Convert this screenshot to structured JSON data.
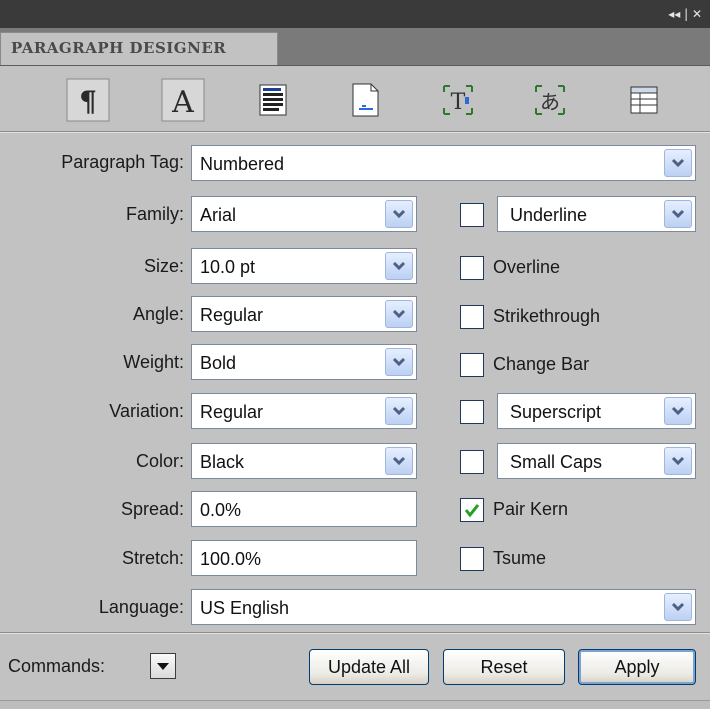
{
  "window": {
    "title_controls": "◂◂ | ✕"
  },
  "tab": {
    "label": "PARAGRAPH DESIGNER"
  },
  "toolbar": {
    "buttons": [
      {
        "icon": "pilcrow-icon"
      },
      {
        "icon": "font-icon"
      },
      {
        "icon": "paragraph-format-icon"
      },
      {
        "icon": "pagination-icon"
      },
      {
        "icon": "text-frame-icon"
      },
      {
        "icon": "asian-text-icon"
      },
      {
        "icon": "table-cell-icon"
      }
    ]
  },
  "paragraph_tag": {
    "label": "Paragraph Tag:",
    "value": "Numbered"
  },
  "family": {
    "label": "Family:",
    "value": "Arial"
  },
  "size": {
    "label": "Size:",
    "value": "10.0 pt"
  },
  "angle": {
    "label": "Angle:",
    "value": "Regular"
  },
  "weight": {
    "label": "Weight:",
    "value": "Bold"
  },
  "variation": {
    "label": "Variation:",
    "value": "Regular"
  },
  "color": {
    "label": "Color:",
    "value": "Black"
  },
  "spread": {
    "label": "Spread:",
    "value": "0.0%"
  },
  "stretch": {
    "label": "Stretch:",
    "value": "100.0%"
  },
  "language": {
    "label": "Language:",
    "value": "US English"
  },
  "options": {
    "underline": {
      "value": "Underline",
      "checked": false
    },
    "overline": {
      "label": "Overline",
      "checked": false
    },
    "strikethrough": {
      "label": "Strikethrough",
      "checked": false
    },
    "change_bar": {
      "label": "Change Bar",
      "checked": false
    },
    "superscript": {
      "value": "Superscript",
      "checked": false
    },
    "small_caps": {
      "value": "Small Caps",
      "checked": false
    },
    "pair_kern": {
      "label": "Pair Kern",
      "checked": true
    },
    "tsume": {
      "label": "Tsume",
      "checked": false
    }
  },
  "commands": {
    "label": "Commands:"
  },
  "buttons": {
    "update_all": "Update All",
    "reset": "Reset",
    "apply": "Apply"
  },
  "colors": {
    "title_bar": "#3a3a3a",
    "panel": "#c2c2c2",
    "check_green": "#21a121",
    "dropdown_arrow": "#bcd0f3"
  }
}
